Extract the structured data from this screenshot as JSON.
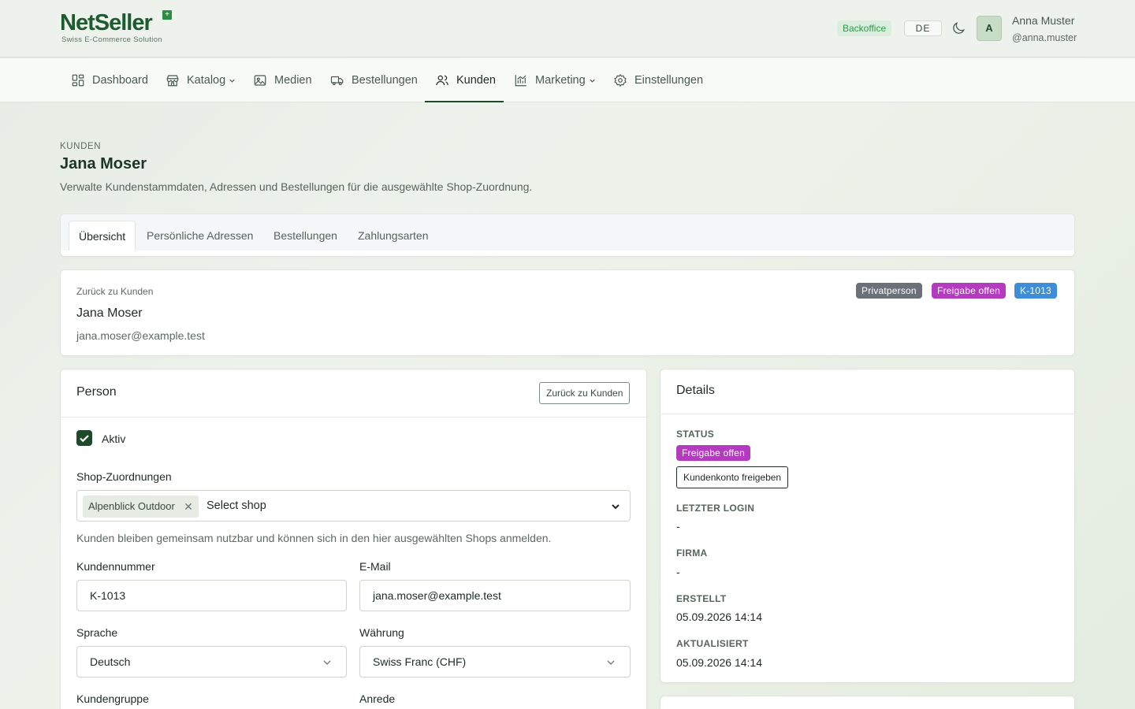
{
  "header": {
    "logo_text": "NetSeller",
    "logo_subtitle": "Swiss E-Commerce Solution",
    "logo_mark": "+",
    "backoffice_badge": "Backoffice",
    "language": "DE",
    "avatar_initial": "A",
    "user_name": "Anna Muster",
    "user_handle": "@anna.muster",
    "icons": [
      "moon-icon"
    ]
  },
  "nav": {
    "items": [
      {
        "label": "Dashboard",
        "icon": "dashboard-icon"
      },
      {
        "label": "Katalog",
        "icon": "store-icon",
        "dropdown": true
      },
      {
        "label": "Medien",
        "icon": "image-icon"
      },
      {
        "label": "Bestellungen",
        "icon": "truck-icon"
      },
      {
        "label": "Kunden",
        "icon": "users-icon",
        "active": true
      },
      {
        "label": "Marketing",
        "icon": "chart-icon",
        "dropdown": true
      },
      {
        "label": "Einstellungen",
        "icon": "gear-icon"
      }
    ]
  },
  "page": {
    "crumb": "KUNDEN",
    "title": "Jana Moser",
    "description": "Verwalte Kundenstammdaten, Adressen und Bestellungen für die ausgewählte Shop-Zuordnung."
  },
  "tabs": [
    "Übersicht",
    "Persönliche Adressen",
    "Bestellungen",
    "Zahlungsarten"
  ],
  "summary": {
    "back_link": "Zurück zu Kunden",
    "name": "Jana Moser",
    "email": "jana.moser@example.test",
    "badges": [
      {
        "label": "Privatperson",
        "color": "#6b7079"
      },
      {
        "label": "Freigabe offen",
        "color": "#b43bbf"
      },
      {
        "label": "K-1013",
        "color": "#3d8ed6"
      }
    ]
  },
  "person": {
    "title": "Person",
    "back_button": "Zurück zu Kunden",
    "active_label": "Aktiv",
    "active_checked": true,
    "shop_label": "Shop-Zuordnungen",
    "shop_tag": "Alpenblick Outdoor",
    "shop_placeholder": "Select shop",
    "shop_help": "Kunden bleiben gemeinsam nutzbar und können sich in den hier ausgewählten Shops anmelden.",
    "customer_number_label": "Kundennummer",
    "customer_number": "K-1013",
    "email_label": "E-Mail",
    "email": "jana.moser@example.test",
    "language_label": "Sprache",
    "language": "Deutsch",
    "currency_label": "Währung",
    "currency": "Swiss Franc (CHF)",
    "group_label": "Kundengruppe",
    "salutation_label": "Anrede"
  },
  "details": {
    "title": "Details",
    "status_label": "STATUS",
    "status_badge": "Freigabe offen",
    "status_color": "#b43bbf",
    "approve_button": "Kundenkonto freigeben",
    "last_login_label": "LETZTER LOGIN",
    "last_login": "-",
    "company_label": "FIRMA",
    "company": "-",
    "created_label": "ERSTELLT",
    "created": "05.09.2026 14:14",
    "updated_label": "AKTUALISIERT",
    "updated": "05.09.2026 14:14"
  }
}
